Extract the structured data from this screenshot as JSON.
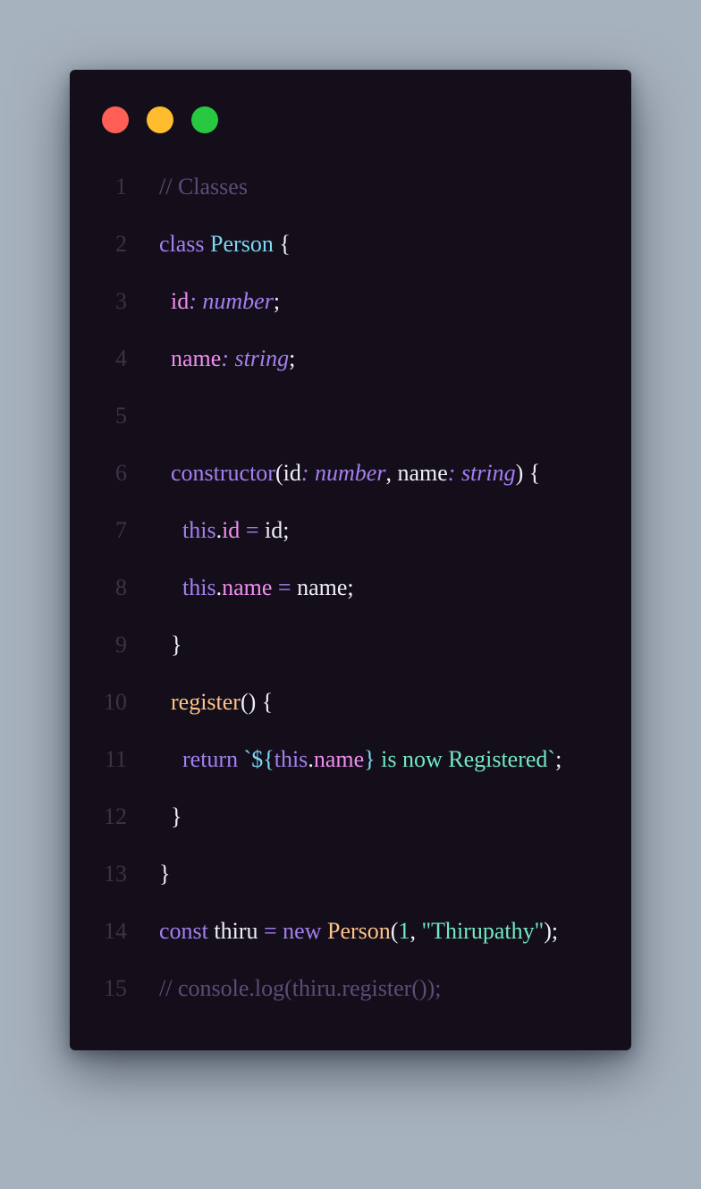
{
  "window": {
    "traffic_lights": [
      "close",
      "minimize",
      "maximize"
    ],
    "colors": {
      "background": "#130e1a",
      "close": "#ff5f57",
      "minimize": "#febc2e",
      "maximize": "#28c840"
    }
  },
  "code": {
    "line_numbers": [
      "1",
      "2",
      "3",
      "4",
      "5",
      "6",
      "7",
      "8",
      "9",
      "10",
      "11",
      "12",
      "13",
      "14",
      "15"
    ],
    "tokens": {
      "l1_comment": "// Classes",
      "l2_class": "class",
      "l2_name": "Person",
      "l2_brace": "{",
      "l3_id": "id",
      "l3_colon_type": ": number",
      "l3_semi": ";",
      "l4_name": "name",
      "l4_colon_type": ": string",
      "l4_semi": ";",
      "l6_constructor": "constructor",
      "l6_paren_open": "(",
      "l6_id": "id",
      "l6_type1": ": number",
      "l6_comma": ",",
      "l6_name": "name",
      "l6_type2": ": string",
      "l6_close": ")",
      "l6_brace": "{",
      "l7_this": "this",
      "l7_dot": ".",
      "l7_prop": "id",
      "l7_eq": "=",
      "l7_val": "id;",
      "l8_this": "this",
      "l8_dot": ".",
      "l8_prop": "name",
      "l8_eq": "=",
      "l8_val": "name;",
      "l9_brace": "}",
      "l10_register": "register",
      "l10_parens": "()",
      "l10_brace": "{",
      "l11_return": "return",
      "l11_tick_open": "`${",
      "l11_this": "this",
      "l11_dot": ".",
      "l11_prop": "name",
      "l11_close_interp": "}",
      "l11_str": " is now Registered`",
      "l11_semi": ";",
      "l12_brace": "}",
      "l13_brace": "}",
      "l14_const": "const",
      "l14_var": "thiru",
      "l14_eq": "=",
      "l14_new": "new",
      "l14_class": "Person",
      "l14_paren": "(",
      "l14_num": "1",
      "l14_comma": ",",
      "l14_str": "\"Thirupathy\"",
      "l14_end": ");",
      "l15_comment": "// console.log(thiru.register());"
    }
  }
}
